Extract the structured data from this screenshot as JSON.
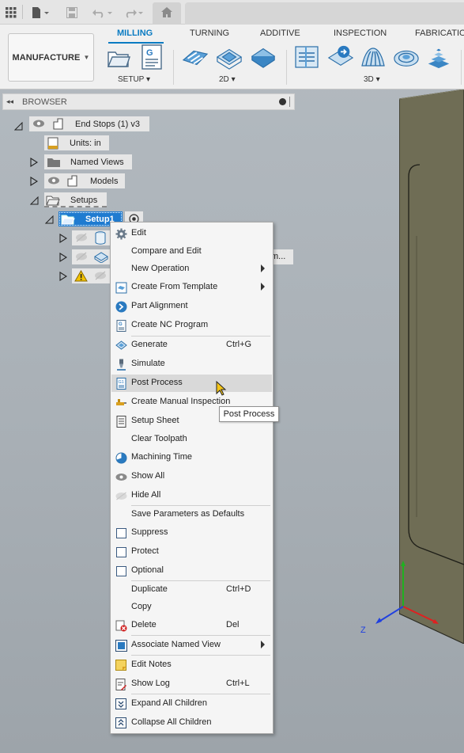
{
  "toolbar": {
    "icons": [
      "grid-icon",
      "file-icon",
      "save-icon",
      "undo-icon",
      "redo-icon",
      "home-icon"
    ]
  },
  "ribbon": {
    "workspace": "MANUFACTURE",
    "tabs": [
      "MILLING",
      "TURNING",
      "ADDITIVE",
      "INSPECTION",
      "FABRICATION"
    ],
    "active_tab": "MILLING",
    "groups": [
      "SETUP",
      "2D",
      "3D"
    ],
    "accent": "#0a7bc2"
  },
  "browser": {
    "title": "BROWSER",
    "root": "End Stops (1) v3",
    "units": "Units: in",
    "named_views": "Named Views",
    "models": "Models",
    "setups": "Setups",
    "setup1": "Setup1",
    "truncated_item": "m..."
  },
  "menu": {
    "items": [
      {
        "label": "Edit",
        "shortcut": "",
        "icon": "gear-icon"
      },
      {
        "label": "Compare and Edit",
        "shortcut": "",
        "icon": ""
      },
      {
        "label": "New Operation",
        "shortcut": "",
        "icon": "",
        "submenu": true
      },
      {
        "label": "Create From Template",
        "shortcut": "",
        "icon": "template-icon",
        "submenu": true
      },
      {
        "label": "Part Alignment",
        "shortcut": "",
        "icon": "part-alignment-icon"
      },
      {
        "label": "Create NC Program",
        "shortcut": "",
        "icon": "nc-program-icon"
      },
      {
        "label": "Generate",
        "shortcut": "Ctrl+G",
        "icon": "generate-icon"
      },
      {
        "label": "Simulate",
        "shortcut": "",
        "icon": "simulate-icon"
      },
      {
        "label": "Post Process",
        "shortcut": "",
        "icon": "post-process-icon",
        "highlighted": true
      },
      {
        "label": "Create Manual Inspection",
        "shortcut": "",
        "icon": "manual-inspection-icon"
      },
      {
        "label": "Setup Sheet",
        "shortcut": "",
        "icon": "setup-sheet-icon"
      },
      {
        "label": "Clear Toolpath",
        "shortcut": "",
        "icon": ""
      },
      {
        "label": "Machining Time",
        "shortcut": "",
        "icon": "pie-chart-icon"
      },
      {
        "label": "Show All",
        "shortcut": "",
        "icon": "eye-icon"
      },
      {
        "label": "Hide All",
        "shortcut": "",
        "icon": "eye-hidden-icon"
      },
      {
        "label": "Save Parameters as Defaults",
        "shortcut": "",
        "icon": ""
      },
      {
        "label": "Suppress",
        "shortcut": "",
        "icon": "checkbox-icon"
      },
      {
        "label": "Protect",
        "shortcut": "",
        "icon": "checkbox-icon"
      },
      {
        "label": "Optional",
        "shortcut": "",
        "icon": "checkbox-icon"
      },
      {
        "label": "Duplicate",
        "shortcut": "Ctrl+D",
        "icon": ""
      },
      {
        "label": "Copy",
        "shortcut": "",
        "icon": ""
      },
      {
        "label": "Delete",
        "shortcut": "Del",
        "icon": "delete-icon"
      },
      {
        "label": "Associate Named View",
        "shortcut": "",
        "icon": "named-view-icon",
        "submenu": true
      },
      {
        "label": "Edit Notes",
        "shortcut": "",
        "icon": "notes-icon"
      },
      {
        "label": "Show Log",
        "shortcut": "Ctrl+L",
        "icon": "log-icon"
      },
      {
        "label": "Expand All Children",
        "shortcut": "",
        "icon": "expand-icon"
      },
      {
        "label": "Collapse All Children",
        "shortcut": "",
        "icon": "collapse-icon"
      }
    ]
  },
  "tooltip": "Post Process",
  "viewport": {
    "axis_label": "Z",
    "axis_colors": {
      "x": "#e02020",
      "y": "#20b020",
      "z": "#2040e0"
    }
  }
}
